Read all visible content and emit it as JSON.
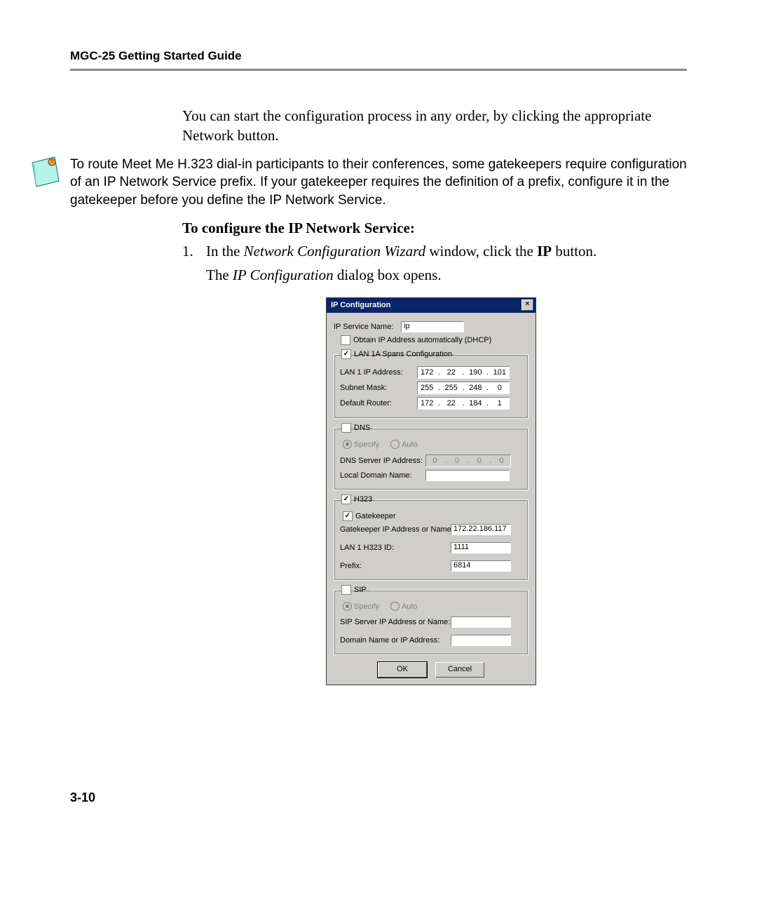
{
  "header": {
    "title": "MGC-25 Getting Started Guide"
  },
  "intro": "You can start the configuration process in any order, by clicking the appropriate Network button.",
  "note": "To route Meet Me H.323 dial-in participants to their conferences, some gatekeepers require configuration of an IP Network Service prefix. If your gatekeeper requires the definition of a prefix, configure it in the gatekeeper before you define the IP Network Service.",
  "section_title": "To configure the IP Network Service:",
  "step1_num": "1.",
  "step1_a": "In the ",
  "step1_b": "Network Configuration Wizard",
  "step1_c": " window, click the ",
  "step1_d": "IP",
  "step1_e": " button.",
  "step1_follow_a": "The ",
  "step1_follow_b": "IP Configuration",
  "step1_follow_c": " dialog box opens.",
  "dialog": {
    "title": "IP Configuration",
    "close": "×",
    "service_label": "IP Service Name:",
    "service_value": "ip",
    "dhcp_label": "Obtain IP Address automatically (DHCP)",
    "dhcp_checked": false,
    "lan_group": {
      "legend": "LAN 1A Spans Configuration",
      "checked": true,
      "ip_label": "LAN 1 IP Address:",
      "ip": [
        "172",
        "22",
        "190",
        "101"
      ],
      "mask_label": "Subnet Mask:",
      "mask": [
        "255",
        "255",
        "248",
        "0"
      ],
      "router_label": "Default Router:",
      "router": [
        "172",
        "22",
        "184",
        "1"
      ]
    },
    "dns_group": {
      "legend": "DNS",
      "checked": false,
      "specify": "Specify",
      "auto": "Auto",
      "server_label": "DNS Server IP Address:",
      "server": [
        "0",
        "0",
        "0",
        "0"
      ],
      "domain_label": "Local Domain Name:",
      "domain_value": ""
    },
    "h323_group": {
      "legend": "H323",
      "checked": true,
      "gk_label": "Gatekeeper",
      "gk_checked": true,
      "gk_addr_label": "Gatekeeper IP Address or Name:",
      "gk_addr_value": "172.22.186.117",
      "h323id_label": "LAN 1 H323 ID:",
      "h323id_value": "1111",
      "prefix_label": "Prefix:",
      "prefix_value": "6814"
    },
    "sip_group": {
      "legend": "SIP",
      "checked": false,
      "specify": "Specify",
      "auto": "Auto",
      "server_label": "SIP Server IP Address or Name:",
      "server_value": "",
      "domain_label": "Domain Name or IP Address:",
      "domain_value": ""
    },
    "ok": "OK",
    "cancel": "Cancel"
  },
  "page_number": "3-10"
}
